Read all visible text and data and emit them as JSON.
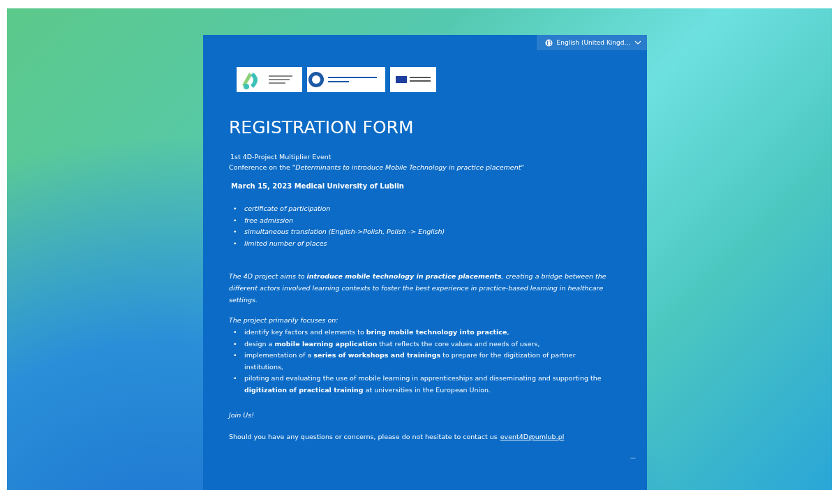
{
  "language_selector": {
    "label": "English (United Kingd..."
  },
  "title": "REGISTRATION FORM",
  "intro": [
    "1st 4D-Project Multiplier Event",
    "Conference on the \"*Determinants to introduce Mobile Technology in practice placement\"*"
  ],
  "date_line": "March 15, 2023 Medical University of Lublin",
  "benefits": [
    "certificate of participation",
    "free admission",
    "simultaneous translation (English->Polish, Polish -> English)",
    "limited number of places"
  ],
  "aim": "The 4D project aims to **introduce mobile technology in practice placements**, creating a bridge between the different actors involved learning contexts to foster the best experience in practice-based learning in healthcare settings.",
  "focus_heading": "The project primarily focuses on:",
  "focus_items": [
    "identify key factors and elements to **bring mobile technology into practice**,",
    "design a **mobile learning application** that reflects the core values and needs of users,",
    "implementation of a **series of workshops and trainings** to prepare for the digitization of partner institutions,",
    "piloting and evaluating the use of mobile learning in apprenticeships and disseminating and supporting the **digitization of practical training** at universities in the European Union."
  ],
  "join": "Join Us!",
  "contact": {
    "text": "Should you have any questions or concerns, please do not hesitate to contact us",
    "email": "event4D@umlub.pl"
  },
  "more": "...",
  "bullet": "•"
}
